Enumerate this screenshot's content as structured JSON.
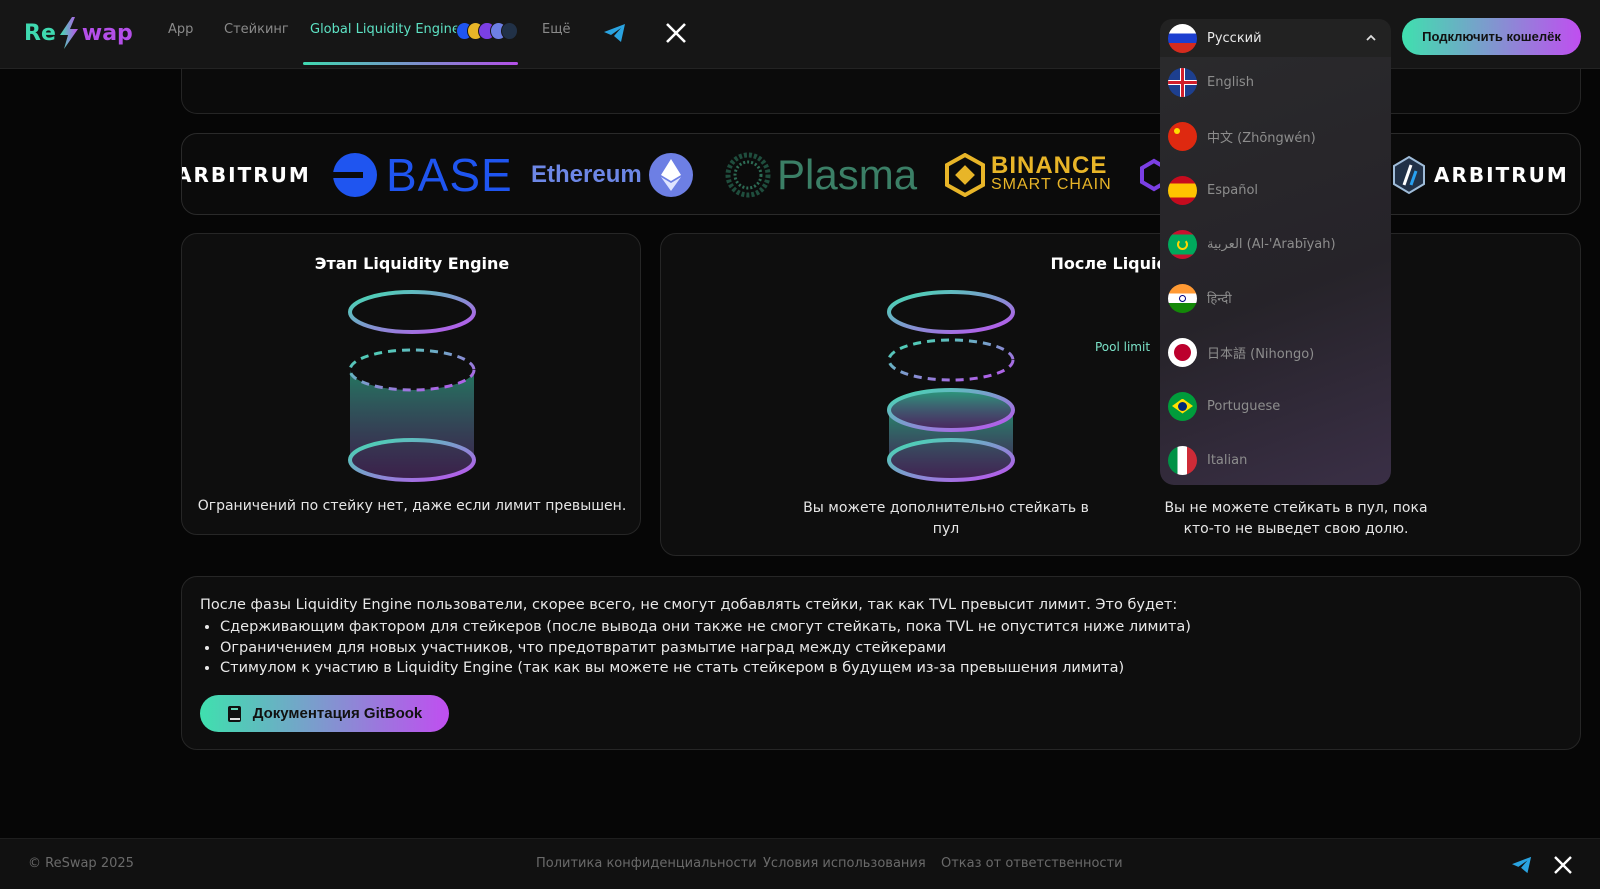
{
  "header": {
    "logo": {
      "re": "Re",
      "wap": "wap"
    },
    "nav": {
      "app": "App",
      "staking": "Стейкинг",
      "global_liquidity_engine": "Global Liquidity Engine",
      "more": "Ещё"
    },
    "social": [
      "telegram-icon",
      "x-icon"
    ],
    "language_selector": {
      "selected": "Русский",
      "flag": "ru"
    },
    "connect_wallet": "Подключить кошелёк"
  },
  "language_menu": {
    "options": [
      {
        "label": "English",
        "flag": "gb"
      },
      {
        "label": "中文 (Zhōngwén)",
        "flag": "cn"
      },
      {
        "label": "Español",
        "flag": "es"
      },
      {
        "label": "العربية (Al-'Arabīyah)",
        "flag": "mr"
      },
      {
        "label": "हिन्दी",
        "flag": "in"
      },
      {
        "label": "日本語 (Nihongo)",
        "flag": "jp"
      },
      {
        "label": "Portuguese",
        "flag": "br"
      },
      {
        "label": "Italian",
        "flag": "it"
      }
    ]
  },
  "chains": {
    "arbitrum_left": "ARBITRUM",
    "base": "BASE",
    "ethereum": "Ethereum",
    "plasma": "Plasma",
    "binance_line1": "BINANCE",
    "binance_line2": "SMART CHAIN",
    "arbitrum_right": "ARBITRUM"
  },
  "cards": {
    "during": {
      "title": "Этап Liquidity Engine",
      "text": "Ограничений по стейку нет, даже если лимит превышен."
    },
    "after": {
      "title": "После Liquidity",
      "pool_limit": "Pool limit",
      "left_text_1": "Вы можете дополнительно стейкать в",
      "left_text_2": "пул",
      "right_text_1": "Вы не можете стейкать в пул, пока",
      "right_text_2": "кто-то не выведет свою долю."
    }
  },
  "info": {
    "intro": "После фазы Liquidity Engine пользователи, скорее всего, не смогут добавлять стейки, так как TVL превысит лимит. Это будет:",
    "bullets": [
      "Сдерживающим фактором для стейкеров (после вывода они также не смогут стейкать, пока TVL не опустится ниже лимита)",
      "Ограничением для новых участников, что предотвратит размытие наград между стейкерами",
      "Стимулом к участию в Liquidity Engine (так как вы можете не стать стейкером в будущем из-за превышения лимита)"
    ],
    "doc_button": "Документация GitBook"
  },
  "footer": {
    "copyright": "© ReSwap 2025",
    "privacy": "Политика конфиденциальности",
    "terms": "Условия использования",
    "disclaimer": "Отказ от ответственности"
  },
  "colors": {
    "accent_green": "#3fe0ae",
    "accent_purple": "#c04ef0",
    "background": "#060606"
  }
}
